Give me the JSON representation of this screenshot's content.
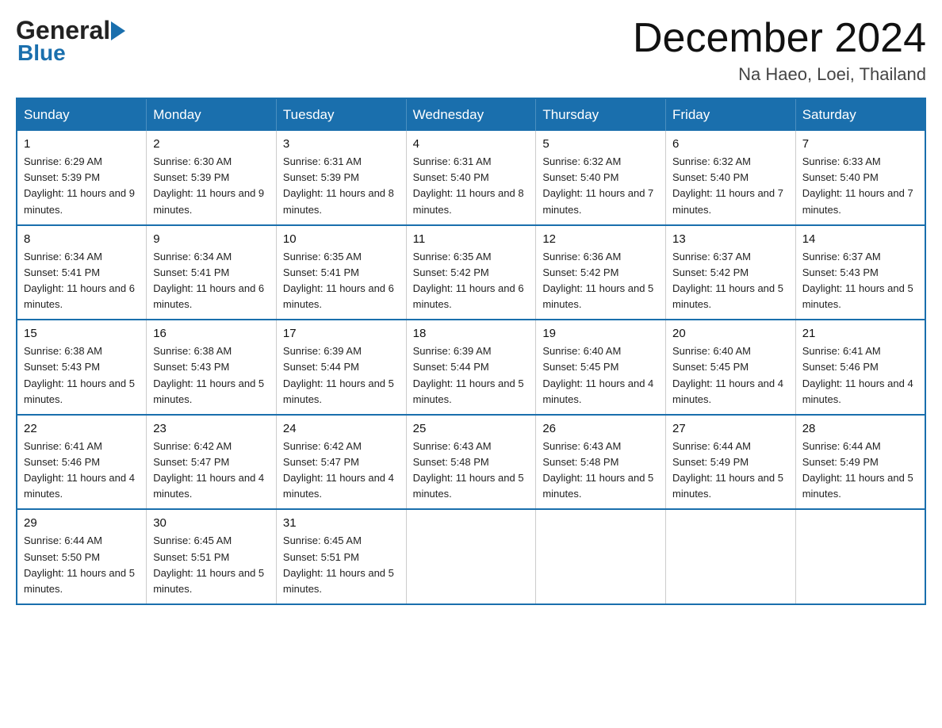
{
  "header": {
    "month_year": "December 2024",
    "location": "Na Haeo, Loei, Thailand",
    "logo_general": "General",
    "logo_blue": "Blue"
  },
  "days_of_week": [
    "Sunday",
    "Monday",
    "Tuesday",
    "Wednesday",
    "Thursday",
    "Friday",
    "Saturday"
  ],
  "weeks": [
    [
      {
        "day": "1",
        "sunrise": "6:29 AM",
        "sunset": "5:39 PM",
        "daylight": "11 hours and 9 minutes."
      },
      {
        "day": "2",
        "sunrise": "6:30 AM",
        "sunset": "5:39 PM",
        "daylight": "11 hours and 9 minutes."
      },
      {
        "day": "3",
        "sunrise": "6:31 AM",
        "sunset": "5:39 PM",
        "daylight": "11 hours and 8 minutes."
      },
      {
        "day": "4",
        "sunrise": "6:31 AM",
        "sunset": "5:40 PM",
        "daylight": "11 hours and 8 minutes."
      },
      {
        "day": "5",
        "sunrise": "6:32 AM",
        "sunset": "5:40 PM",
        "daylight": "11 hours and 7 minutes."
      },
      {
        "day": "6",
        "sunrise": "6:32 AM",
        "sunset": "5:40 PM",
        "daylight": "11 hours and 7 minutes."
      },
      {
        "day": "7",
        "sunrise": "6:33 AM",
        "sunset": "5:40 PM",
        "daylight": "11 hours and 7 minutes."
      }
    ],
    [
      {
        "day": "8",
        "sunrise": "6:34 AM",
        "sunset": "5:41 PM",
        "daylight": "11 hours and 6 minutes."
      },
      {
        "day": "9",
        "sunrise": "6:34 AM",
        "sunset": "5:41 PM",
        "daylight": "11 hours and 6 minutes."
      },
      {
        "day": "10",
        "sunrise": "6:35 AM",
        "sunset": "5:41 PM",
        "daylight": "11 hours and 6 minutes."
      },
      {
        "day": "11",
        "sunrise": "6:35 AM",
        "sunset": "5:42 PM",
        "daylight": "11 hours and 6 minutes."
      },
      {
        "day": "12",
        "sunrise": "6:36 AM",
        "sunset": "5:42 PM",
        "daylight": "11 hours and 5 minutes."
      },
      {
        "day": "13",
        "sunrise": "6:37 AM",
        "sunset": "5:42 PM",
        "daylight": "11 hours and 5 minutes."
      },
      {
        "day": "14",
        "sunrise": "6:37 AM",
        "sunset": "5:43 PM",
        "daylight": "11 hours and 5 minutes."
      }
    ],
    [
      {
        "day": "15",
        "sunrise": "6:38 AM",
        "sunset": "5:43 PM",
        "daylight": "11 hours and 5 minutes."
      },
      {
        "day": "16",
        "sunrise": "6:38 AM",
        "sunset": "5:43 PM",
        "daylight": "11 hours and 5 minutes."
      },
      {
        "day": "17",
        "sunrise": "6:39 AM",
        "sunset": "5:44 PM",
        "daylight": "11 hours and 5 minutes."
      },
      {
        "day": "18",
        "sunrise": "6:39 AM",
        "sunset": "5:44 PM",
        "daylight": "11 hours and 5 minutes."
      },
      {
        "day": "19",
        "sunrise": "6:40 AM",
        "sunset": "5:45 PM",
        "daylight": "11 hours and 4 minutes."
      },
      {
        "day": "20",
        "sunrise": "6:40 AM",
        "sunset": "5:45 PM",
        "daylight": "11 hours and 4 minutes."
      },
      {
        "day": "21",
        "sunrise": "6:41 AM",
        "sunset": "5:46 PM",
        "daylight": "11 hours and 4 minutes."
      }
    ],
    [
      {
        "day": "22",
        "sunrise": "6:41 AM",
        "sunset": "5:46 PM",
        "daylight": "11 hours and 4 minutes."
      },
      {
        "day": "23",
        "sunrise": "6:42 AM",
        "sunset": "5:47 PM",
        "daylight": "11 hours and 4 minutes."
      },
      {
        "day": "24",
        "sunrise": "6:42 AM",
        "sunset": "5:47 PM",
        "daylight": "11 hours and 4 minutes."
      },
      {
        "day": "25",
        "sunrise": "6:43 AM",
        "sunset": "5:48 PM",
        "daylight": "11 hours and 5 minutes."
      },
      {
        "day": "26",
        "sunrise": "6:43 AM",
        "sunset": "5:48 PM",
        "daylight": "11 hours and 5 minutes."
      },
      {
        "day": "27",
        "sunrise": "6:44 AM",
        "sunset": "5:49 PM",
        "daylight": "11 hours and 5 minutes."
      },
      {
        "day": "28",
        "sunrise": "6:44 AM",
        "sunset": "5:49 PM",
        "daylight": "11 hours and 5 minutes."
      }
    ],
    [
      {
        "day": "29",
        "sunrise": "6:44 AM",
        "sunset": "5:50 PM",
        "daylight": "11 hours and 5 minutes."
      },
      {
        "day": "30",
        "sunrise": "6:45 AM",
        "sunset": "5:51 PM",
        "daylight": "11 hours and 5 minutes."
      },
      {
        "day": "31",
        "sunrise": "6:45 AM",
        "sunset": "5:51 PM",
        "daylight": "11 hours and 5 minutes."
      },
      null,
      null,
      null,
      null
    ]
  ],
  "labels": {
    "sunrise_prefix": "Sunrise: ",
    "sunset_prefix": "Sunset: ",
    "daylight_prefix": "Daylight: "
  }
}
